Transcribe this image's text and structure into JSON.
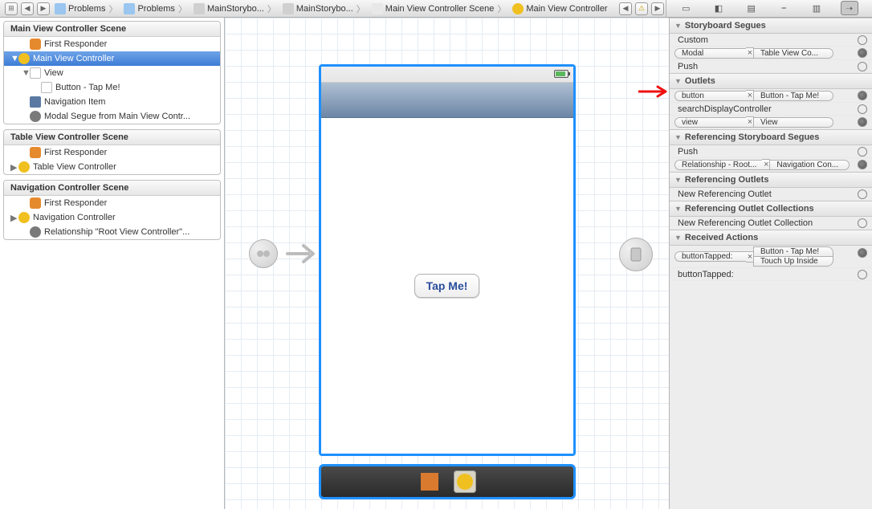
{
  "toolbar": {
    "back": "◀",
    "forward": "▶",
    "crumbs": [
      {
        "icon": "ci-folder",
        "label": "Problems"
      },
      {
        "icon": "ci-folder",
        "label": "Problems"
      },
      {
        "icon": "ci-story",
        "label": "MainStorybo..."
      },
      {
        "icon": "ci-story",
        "label": "MainStorybo..."
      },
      {
        "icon": "ci-scene",
        "label": "Main View Controller Scene"
      },
      {
        "icon": "ci-vc",
        "label": "Main View Controller"
      }
    ],
    "end_back": "◀",
    "end_warn": "⚠",
    "end_fwd": "▶"
  },
  "outline": {
    "scenes": [
      {
        "title": "Main View Controller Scene",
        "rows": [
          {
            "icon": "oi-responder",
            "label": "First Responder",
            "indent": 1
          },
          {
            "icon": "oi-vc",
            "label": "Main View Controller",
            "indent": 0,
            "selected": true,
            "disclosure": "▼"
          },
          {
            "icon": "oi-view",
            "label": "View",
            "indent": 1,
            "disclosure": "▼"
          },
          {
            "icon": "oi-button",
            "label": "Button - Tap Me!",
            "indent": 2
          },
          {
            "icon": "oi-nav",
            "label": "Navigation Item",
            "indent": 1
          },
          {
            "icon": "oi-segue",
            "label": "Modal Segue from Main View Contr...",
            "indent": 1
          }
        ]
      },
      {
        "title": "Table View Controller Scene",
        "rows": [
          {
            "icon": "oi-responder",
            "label": "First Responder",
            "indent": 1
          },
          {
            "icon": "oi-tvc",
            "label": "Table View Controller",
            "indent": 0,
            "disclosure": "▶"
          }
        ]
      },
      {
        "title": "Navigation Controller Scene",
        "rows": [
          {
            "icon": "oi-responder",
            "label": "First Responder",
            "indent": 1
          },
          {
            "icon": "oi-navctrl",
            "label": "Navigation Controller",
            "indent": 0,
            "disclosure": "▶"
          },
          {
            "icon": "oi-segue",
            "label": "Relationship \"Root View Controller\"...",
            "indent": 1
          }
        ]
      }
    ]
  },
  "canvas": {
    "button_label": "Tap Me!"
  },
  "inspector": {
    "sections": [
      {
        "title": "Storyboard Segues",
        "rows": [
          {
            "type": "plain",
            "label": "Custom",
            "filled": false
          },
          {
            "type": "conn",
            "left": "Modal",
            "right": "Table View Co...",
            "filled": true
          },
          {
            "type": "plain",
            "label": "Push",
            "filled": false
          }
        ]
      },
      {
        "title": "Outlets",
        "rows": [
          {
            "type": "conn",
            "left": "button",
            "right": "Button - Tap Me!",
            "filled": true
          },
          {
            "type": "plain",
            "label": "searchDisplayController",
            "filled": false
          },
          {
            "type": "conn",
            "left": "view",
            "right": "View",
            "filled": true
          }
        ]
      },
      {
        "title": "Referencing Storyboard Segues",
        "rows": [
          {
            "type": "plain",
            "label": "Push",
            "filled": false
          },
          {
            "type": "conn",
            "left": "Relationship - Root...",
            "right": "Navigation Con...",
            "filled": true
          }
        ]
      },
      {
        "title": "Referencing Outlets",
        "rows": [
          {
            "type": "plain",
            "label": "New Referencing Outlet",
            "filled": false
          }
        ]
      },
      {
        "title": "Referencing Outlet Collections",
        "rows": [
          {
            "type": "plain",
            "label": "New Referencing Outlet Collection",
            "filled": false
          }
        ]
      },
      {
        "title": "Received Actions",
        "rows": [
          {
            "type": "conn2",
            "left": "buttonTapped:",
            "right": "Button - Tap Me!",
            "sub": "Touch Up Inside",
            "filled": true
          },
          {
            "type": "plain",
            "label": "buttonTapped:",
            "filled": false
          }
        ]
      }
    ]
  }
}
